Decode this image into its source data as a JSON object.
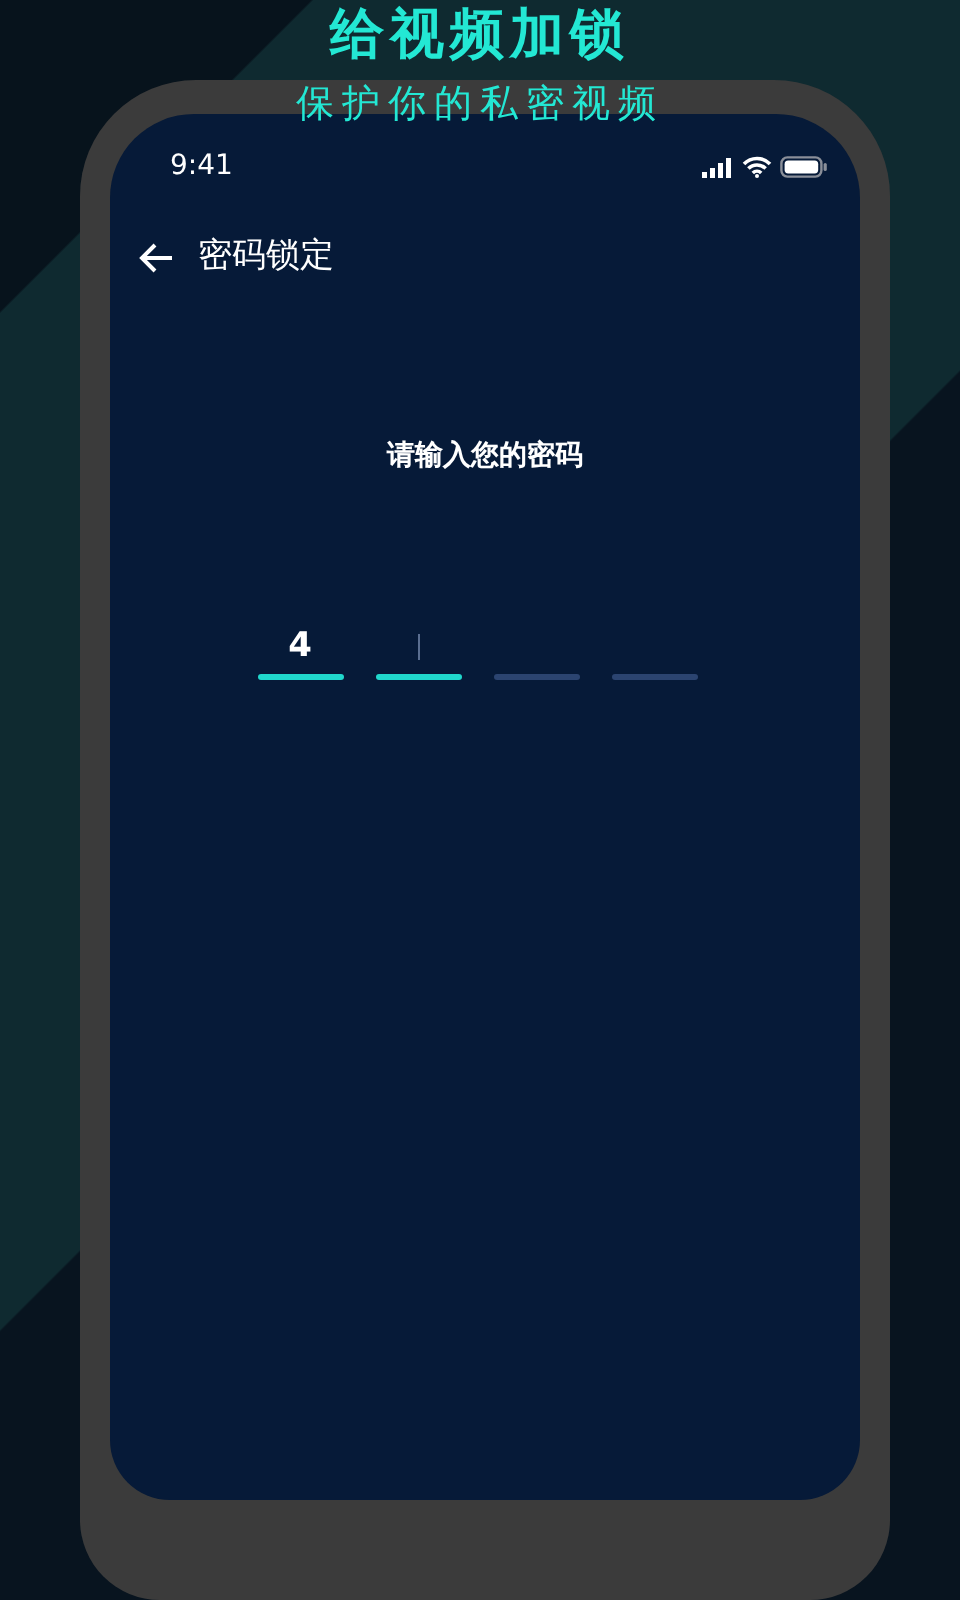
{
  "banner": {
    "title": "给视频加锁",
    "subtitle": "保护你的私密视频"
  },
  "status_bar": {
    "time": "9:41"
  },
  "header": {
    "title": "密码锁定"
  },
  "prompt": "请输入您的密码",
  "pin_slots": [
    {
      "value": "4",
      "active": true,
      "cursor": false
    },
    {
      "active": true,
      "cursor": true
    },
    {
      "active": false,
      "cursor": false
    },
    {
      "active": false,
      "cursor": false
    }
  ]
}
